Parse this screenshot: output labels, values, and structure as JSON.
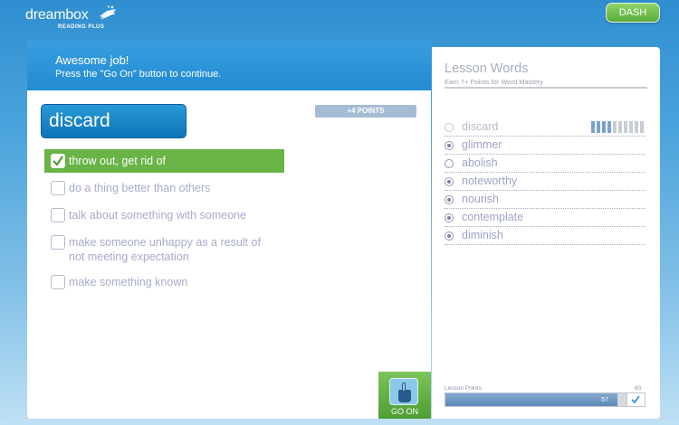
{
  "header": {
    "brand": "dreambox",
    "brand_sub": "READING PLUS",
    "dash_label": "DASH"
  },
  "feedback": {
    "title": "Awesome job!",
    "message": "Press the \"Go On\" button to continue."
  },
  "question": {
    "word": "discard",
    "points": "+4 POINTS",
    "options": [
      {
        "text": "throw out, get rid of",
        "selected": true
      },
      {
        "text": "do a thing better than others",
        "selected": false
      },
      {
        "text": "talk about something with someone",
        "selected": false
      },
      {
        "text": "make someone unhappy as a result of not meeting expectation",
        "selected": false
      },
      {
        "text": "make something known",
        "selected": false
      }
    ]
  },
  "go_on": {
    "label": "GO ON",
    "icon": "hand-pointer-icon"
  },
  "lesson_words": {
    "title": "Lesson Words",
    "subtitle": "Earn 7+ Points for Word Mastery",
    "words": [
      {
        "word": "discard",
        "status": "current",
        "mastery_points": 4,
        "mastery_target": 10
      },
      {
        "word": "glimmer",
        "status": "filled"
      },
      {
        "word": "abolish",
        "status": "empty"
      },
      {
        "word": "noteworthy",
        "status": "filled"
      },
      {
        "word": "nourish",
        "status": "filled"
      },
      {
        "word": "contemplate",
        "status": "filled"
      },
      {
        "word": "diminish",
        "status": "filled"
      }
    ]
  },
  "lesson_points": {
    "label": "Lesson Points",
    "max_label": "60",
    "value_label": "57",
    "value": 57,
    "max": 60
  },
  "colors": {
    "accent_blue": "#228bd2",
    "success_green": "#68b446",
    "muted_text": "#a7abcc"
  }
}
